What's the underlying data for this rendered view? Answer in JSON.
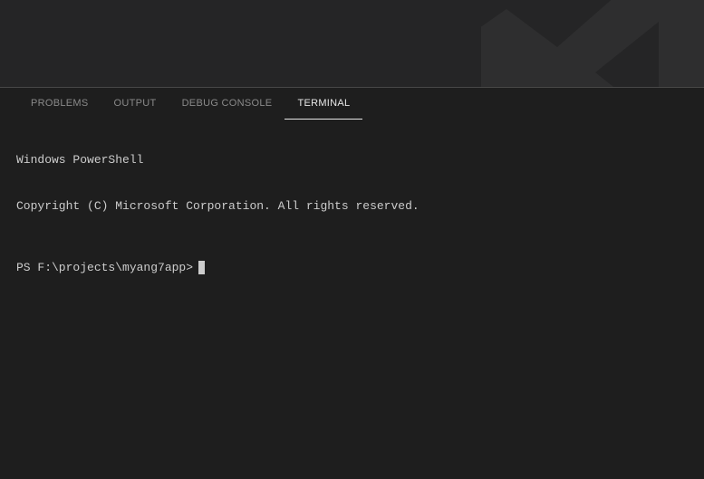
{
  "panel": {
    "tabs": {
      "problems": "PROBLEMS",
      "output": "OUTPUT",
      "debug_console": "DEBUG CONSOLE",
      "terminal": "TERMINAL"
    }
  },
  "terminal": {
    "line1": "Windows PowerShell",
    "line2": "Copyright (C) Microsoft Corporation. All rights reserved.",
    "prompt": "PS F:\\projects\\myang7app>"
  }
}
